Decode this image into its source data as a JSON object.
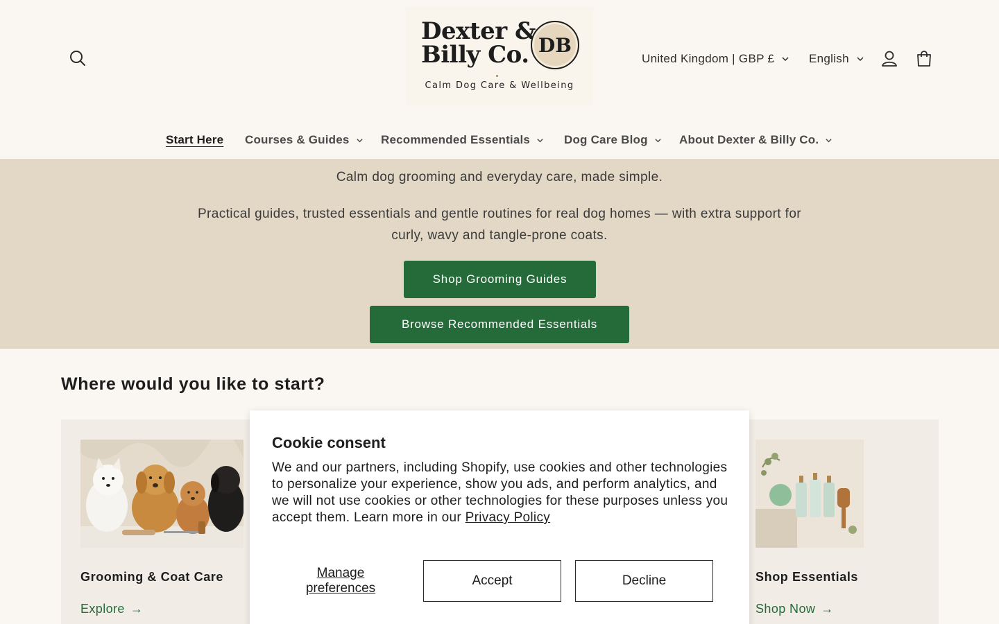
{
  "header": {
    "logo": {
      "line1": "Dexter &",
      "line2": "Billy Co.",
      "monogram": "DB",
      "tagline": "Calm Dog Care & Wellbeing"
    },
    "country_selector": "United Kingdom | GBP £",
    "language_selector": "English",
    "icons": {
      "search": "search-icon",
      "account": "user-icon",
      "cart": "shopping-bag-icon"
    }
  },
  "nav": {
    "items": [
      {
        "label": "Start Here",
        "active": true,
        "dropdown": false
      },
      {
        "label": "Courses & Guides",
        "active": false,
        "dropdown": true
      },
      {
        "label": "Recommended Essentials",
        "active": false,
        "dropdown": true
      },
      {
        "label": "Dog Care Blog",
        "active": false,
        "dropdown": true
      },
      {
        "label": "About Dexter & Billy Co.",
        "active": false,
        "dropdown": true
      }
    ]
  },
  "hero": {
    "subtitle": "Calm dog grooming and everyday care, made simple.",
    "body": "Practical guides, trusted essentials and gentle routines for real dog homes — with extra support for curly, wavy and tangle-prone coats.",
    "buttons": {
      "guides": "Shop Grooming Guides",
      "essentials": "Browse Recommended Essentials"
    }
  },
  "start_section": {
    "title": "Where would you like to start?",
    "cards": [
      {
        "title": "Grooming & Coat Care",
        "link": "Explore"
      },
      {
        "title": "Shop Essentials",
        "link": "Shop Now"
      }
    ]
  },
  "cookie": {
    "title": "Cookie consent",
    "body": "We and our partners, including Shopify, use cookies and other technologies to personalize your experience, show you ads, and perform analytics, and we will not use cookies or other technologies for these purposes unless you accept them. Learn more in our ",
    "privacy_link": "Privacy Policy",
    "manage": "Manage preferences",
    "accept": "Accept",
    "decline": "Decline"
  },
  "colors": {
    "page_bg": "#faf6f1",
    "hero_bg": "#e3d8c6",
    "brand_green": "#256b3a",
    "card_bg": "#f1ece6"
  }
}
